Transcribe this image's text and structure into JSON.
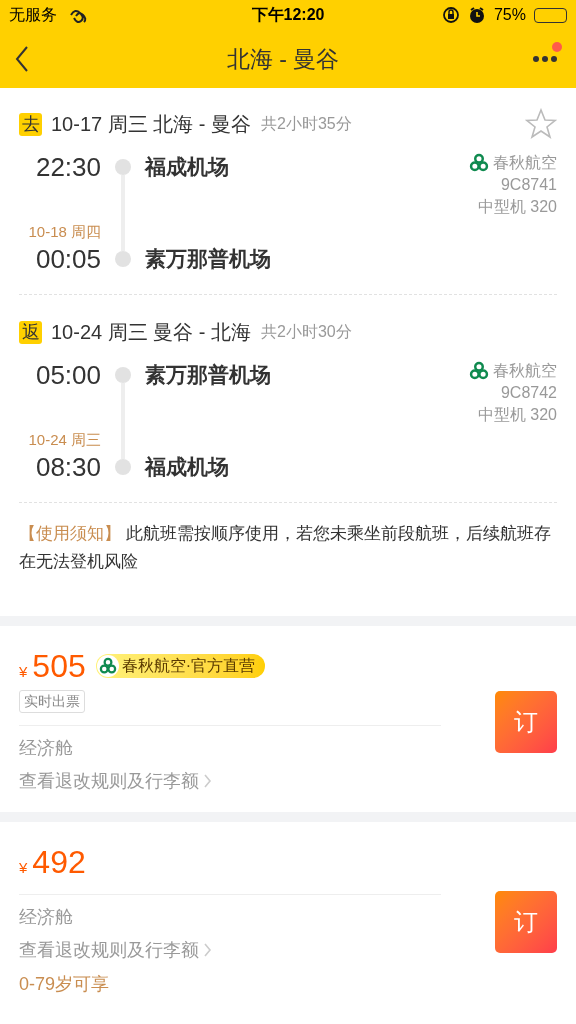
{
  "status_bar": {
    "carrier": "无服务",
    "time": "下午12:20",
    "battery": "75%"
  },
  "nav": {
    "title": "北海 - 曼谷",
    "has_notification": true
  },
  "starred": false,
  "legs": [
    {
      "tag": "去",
      "date_route": "10-17 周三 北海 - 曼谷",
      "duration": "共2小时35分",
      "depart_time": "22:30",
      "depart_airport": "福成机场",
      "arrive_date": "10-18 周四",
      "arrive_time": "00:05",
      "arrive_airport": "素万那普机场",
      "airline": "春秋航空",
      "flight_no": "9C8741",
      "aircraft": "中型机 320"
    },
    {
      "tag": "返",
      "date_route": "10-24 周三 曼谷 - 北海",
      "duration": "共2小时30分",
      "depart_time": "05:00",
      "depart_airport": "素万那普机场",
      "arrive_date": "10-24 周三",
      "arrive_time": "08:30",
      "arrive_airport": "福成机场",
      "airline": "春秋航空",
      "flight_no": "9C8742",
      "aircraft": "中型机 320"
    }
  ],
  "notice": {
    "label": "【使用须知】",
    "text": "此航班需按顺序使用，若您未乘坐前段航班，后续航班存在无法登机风险"
  },
  "offers": [
    {
      "currency": "¥",
      "price": "505",
      "badge": "春秋航空·官方直营",
      "tags": [
        "实时出票"
      ],
      "cabin": "经济舱",
      "rules_link": "查看退改规则及行李额",
      "button": "订"
    },
    {
      "currency": "¥",
      "price": "492",
      "cabin": "经济舱",
      "rules_link": "查看退改规则及行李额",
      "eligibility": "0-79岁可享",
      "button": "订"
    }
  ]
}
